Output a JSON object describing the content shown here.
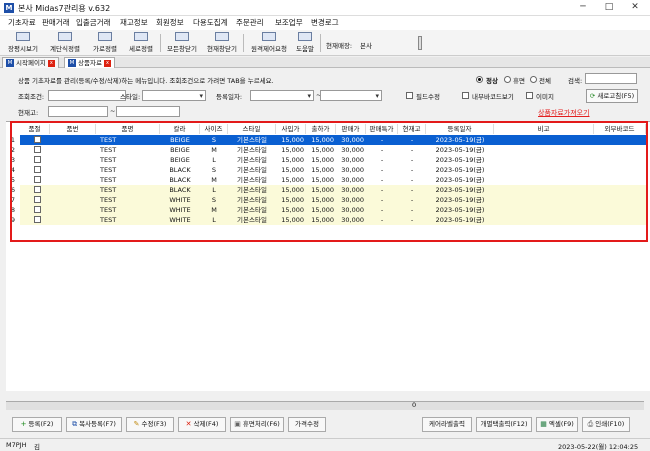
{
  "window": {
    "title": "본사 Midas7관리용 v.632",
    "app_icon": "M",
    "minimize": "─",
    "maximize": "□",
    "close": "✕"
  },
  "menu": [
    "기초자료",
    "판매거래",
    "입출금거래",
    "재고정보",
    "회원정보",
    "다용도집계",
    "주문관리",
    "보조업무",
    "변경로그"
  ],
  "toolbar": {
    "buttons": [
      "장평시보기",
      "계단식정렬",
      "가로정렬",
      "세로정렬",
      "모든창닫기",
      "현재창닫기",
      "원격제어요청",
      "도움말"
    ],
    "store_label": "현재매장:",
    "store_value": "본사"
  },
  "tabs": [
    {
      "icon": "M",
      "label": "시작페이지",
      "close": "x"
    },
    {
      "icon": "M",
      "label": "상품자료",
      "close": "x"
    }
  ],
  "form": {
    "description": "상품 기초자료를 관리(등록/수정/삭제)하는 메뉴입니다. 조회조건으로 가려면 TAB을 누르세요.",
    "status_radios": [
      "정상",
      "휴면",
      "전체"
    ],
    "status_selected": 0,
    "search_label": "검색:",
    "cond_label": "조회조건:",
    "style_label": "스타일:",
    "date_label": "등록일자:",
    "dash": "~",
    "stock_label": "현재고:",
    "checks": [
      "필드수정",
      "내부바코드보기",
      "이미지"
    ],
    "refresh_label": "새로고침(F5)",
    "import_link": "상품자료가져오기"
  },
  "grid": {
    "columns": [
      "품절",
      "품번",
      "품명",
      "칼라",
      "사이즈",
      "스타일",
      "사입가",
      "출하가",
      "판매가",
      "판매특가",
      "현재고",
      "등록일자",
      "비고",
      "외부바코드"
    ],
    "rows": [
      [
        "1",
        "",
        "TEST",
        "BEIGE",
        "S",
        "기본스타일",
        "15,000",
        "15,000",
        "30,000",
        "-",
        "-",
        "2023-05-19(금)",
        "",
        ""
      ],
      [
        "2",
        "",
        "TEST",
        "BEIGE",
        "M",
        "기본스타일",
        "15,000",
        "15,000",
        "30,000",
        "-",
        "-",
        "2023-05-19(금)",
        "",
        ""
      ],
      [
        "3",
        "",
        "TEST",
        "BEIGE",
        "L",
        "기본스타일",
        "15,000",
        "15,000",
        "30,000",
        "-",
        "-",
        "2023-05-19(금)",
        "",
        ""
      ],
      [
        "4",
        "",
        "TEST",
        "BLACK",
        "S",
        "기본스타일",
        "15,000",
        "15,000",
        "30,000",
        "-",
        "-",
        "2023-05-19(금)",
        "",
        ""
      ],
      [
        "5",
        "",
        "TEST",
        "BLACK",
        "M",
        "기본스타일",
        "15,000",
        "15,000",
        "30,000",
        "-",
        "-",
        "2023-05-19(금)",
        "",
        ""
      ],
      [
        "6",
        "",
        "TEST",
        "BLACK",
        "L",
        "기본스타일",
        "15,000",
        "15,000",
        "30,000",
        "-",
        "-",
        "2023-05-19(금)",
        "",
        ""
      ],
      [
        "7",
        "",
        "TEST",
        "WHITE",
        "S",
        "기본스타일",
        "15,000",
        "15,000",
        "30,000",
        "-",
        "-",
        "2023-05-19(금)",
        "",
        ""
      ],
      [
        "8",
        "",
        "TEST",
        "WHITE",
        "M",
        "기본스타일",
        "15,000",
        "15,000",
        "30,000",
        "-",
        "-",
        "2023-05-19(금)",
        "",
        ""
      ],
      [
        "9",
        "",
        "TEST",
        "WHITE",
        "L",
        "기본스타일",
        "15,000",
        "15,000",
        "30,000",
        "-",
        "-",
        "2023-05-19(금)",
        "",
        ""
      ]
    ],
    "selected_row": 0,
    "footer_count": "0",
    "colors": {
      "selected": "#0a5fd1",
      "stripe": "#fbfad9",
      "highlight": "#e31a1a"
    }
  },
  "bottom_buttons": [
    {
      "icon": "plus-icon",
      "glyph": "+",
      "label": "등록(F2)"
    },
    {
      "icon": "copy-icon",
      "glyph": "⧉",
      "label": "복사등록(F7)"
    },
    {
      "icon": "pencil-icon",
      "glyph": "✎",
      "label": "수정(F3)"
    },
    {
      "icon": "delete-icon",
      "glyph": "✕",
      "label": "삭제(F4)"
    },
    {
      "icon": "trash-icon",
      "glyph": "🗑",
      "label": "휴면처리(F6)"
    },
    {
      "icon": "",
      "glyph": "",
      "label": "가격수정"
    },
    {
      "icon": "",
      "glyph": "",
      "label": "케어라벨출력"
    },
    {
      "icon": "",
      "glyph": "",
      "label": "개별택출력(F12)"
    },
    {
      "icon": "excel-icon",
      "glyph": "▦",
      "label": "엑셀(F9)"
    },
    {
      "icon": "print-icon",
      "glyph": "⎙",
      "label": "인쇄(F10)"
    }
  ],
  "status": {
    "left": "M7PJH",
    "ime": "김",
    "datetime": "2023-05-22(월) 12:04:25"
  }
}
